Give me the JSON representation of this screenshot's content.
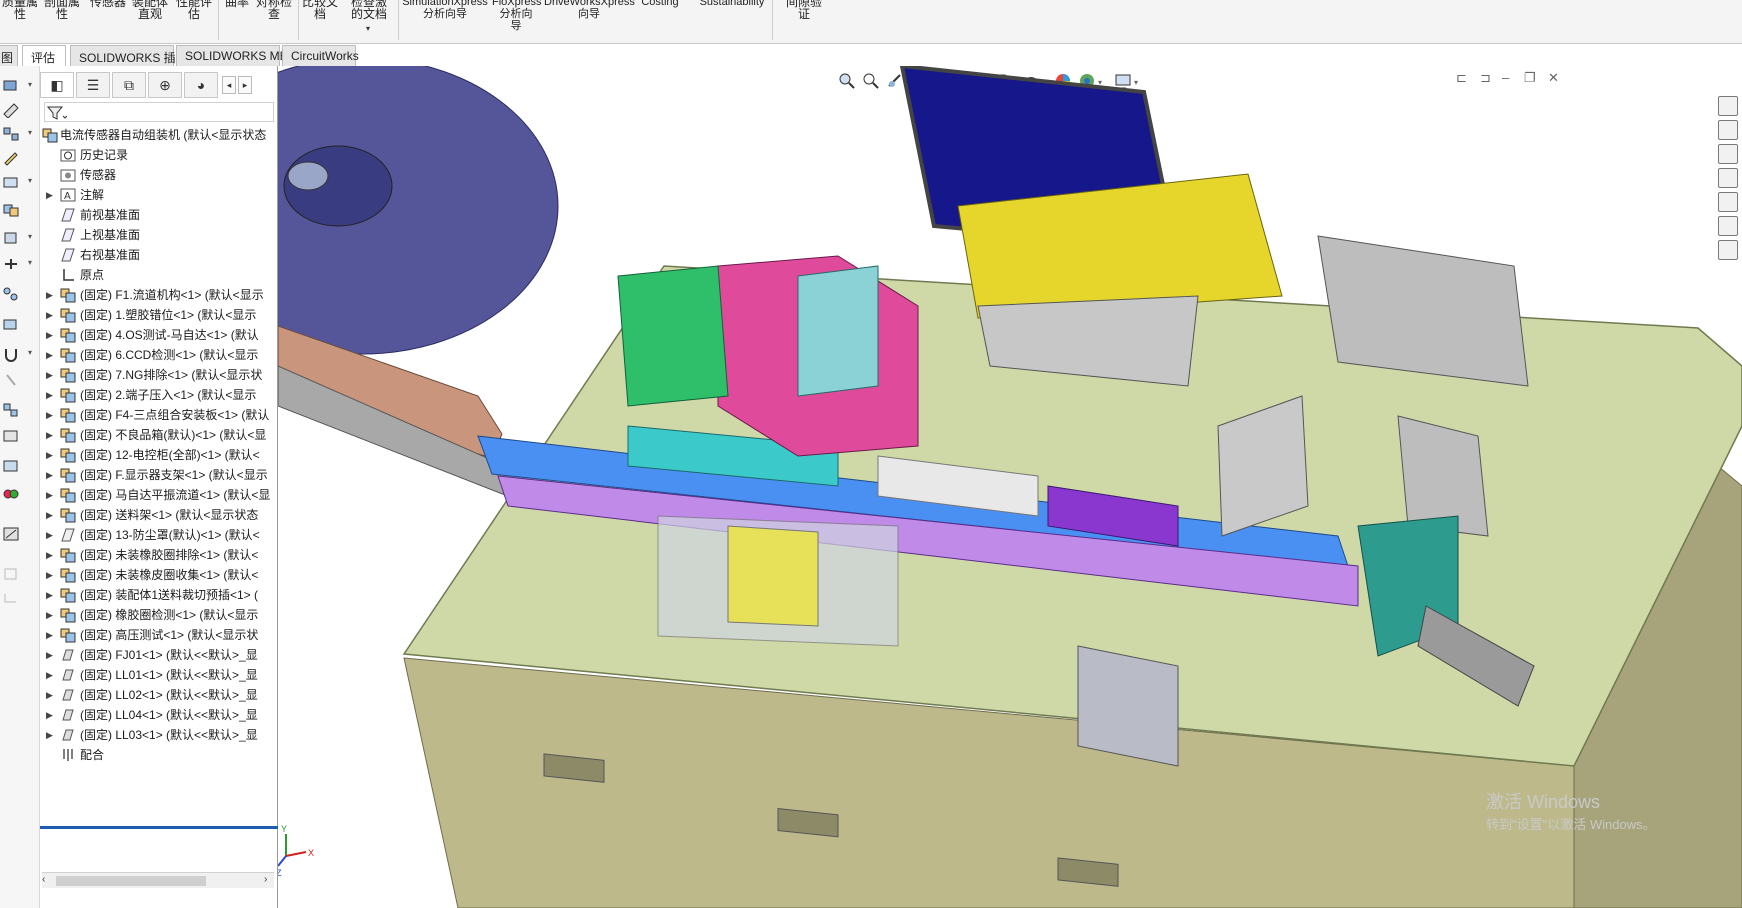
{
  "ribbon": {
    "groups": [
      {
        "label": "质量属\n性"
      },
      {
        "label": "剖面属\n性"
      },
      {
        "label": "传感器"
      },
      {
        "label": "装配体\n直观"
      },
      {
        "label": "性能评\n估"
      },
      {
        "label": "曲率"
      },
      {
        "label": "对称检\n查"
      },
      {
        "label": "比较文\n档"
      },
      {
        "label": "检查激\n的文档"
      },
      {
        "label": "SimulationXpress\n分析向导"
      },
      {
        "label": "FloXpress\n分析向\n导"
      },
      {
        "label": "DriveWorksXpress\n向导"
      },
      {
        "label": "Costing"
      },
      {
        "label": "Sustainability"
      },
      {
        "label": "间隙验\n证"
      }
    ]
  },
  "tabs": [
    {
      "label": "图"
    },
    {
      "label": "评估",
      "active": true
    },
    {
      "label": "SOLIDWORKS 插件"
    },
    {
      "label": "SOLIDWORKS MBD"
    },
    {
      "label": "CircuitWorks"
    }
  ],
  "feature_manager": {
    "root": {
      "label": "电流传感器自动组装机  (默认<显示状态"
    },
    "items": [
      {
        "label": "历史记录",
        "icon": "history-icon"
      },
      {
        "label": "传感器",
        "icon": "sensor-icon"
      },
      {
        "label": "注解",
        "icon": "annotation-icon"
      },
      {
        "label": "前视基准面",
        "icon": "plane-icon"
      },
      {
        "label": "上视基准面",
        "icon": "plane-icon"
      },
      {
        "label": "右视基准面",
        "icon": "plane-icon"
      },
      {
        "label": "原点",
        "icon": "origin-icon"
      },
      {
        "label": "(固定) F1.流道机构<1> (默认<显示"
      },
      {
        "label": "(固定) 1.塑胶错位<1> (默认<显示"
      },
      {
        "label": "(固定) 4.OS测试-马自达<1> (默认"
      },
      {
        "label": "(固定) 6.CCD检测<1> (默认<显示"
      },
      {
        "label": "(固定) 7.NG排除<1> (默认<显示状"
      },
      {
        "label": "(固定) 2.端子压入<1> (默认<显示"
      },
      {
        "label": "(固定) F4-三点组合安装板<1> (默认"
      },
      {
        "label": "(固定) 不良品箱(默认)<1> (默认<显"
      },
      {
        "label": "(固定) 12-电控柜(全部)<1> (默认<"
      },
      {
        "label": "(固定) F.显示器支架<1> (默认<显示"
      },
      {
        "label": "(固定) 马自达平振流道<1> (默认<显"
      },
      {
        "label": "(固定) 送料架<1> (默认<显示状态"
      },
      {
        "label": "(固定) 13-防尘罩(默认)<1> (默认<"
      },
      {
        "label": "(固定) 未装橡胶圈排除<1> (默认<"
      },
      {
        "label": "(固定) 未装橡皮圈收集<1> (默认<"
      },
      {
        "label": "(固定) 装配体1送料裁切预插<1> ("
      },
      {
        "label": "(固定) 橡胶圈检测<1> (默认<显示"
      },
      {
        "label": "(固定) 高压测试<1> (默认<显示状"
      },
      {
        "label": "(固定) FJ01<1> (默认<<默认>_显"
      },
      {
        "label": "(固定) LL01<1> (默认<<默认>_显"
      },
      {
        "label": "(固定) LL02<1> (默认<<默认>_显"
      },
      {
        "label": "(固定) LL04<1> (默认<<默认>_显"
      },
      {
        "label": "(固定) LL03<1> (默认<<默认>_显"
      },
      {
        "label": "配合",
        "icon": "mates-icon"
      }
    ]
  },
  "viewport": {
    "triad_labels": {
      "x": "X",
      "y": "Y",
      "z": "Z"
    },
    "watermark_line1": "激活 Windows",
    "watermark_line2": "转到\"设置\"以激活 Windows。"
  },
  "colors": {
    "table_top": "#cfd9a8",
    "cabinet": "#bdb98a",
    "disc": "#55569a",
    "monitor_screen": "#15178a",
    "monitor_stand": "#e6d62b"
  }
}
